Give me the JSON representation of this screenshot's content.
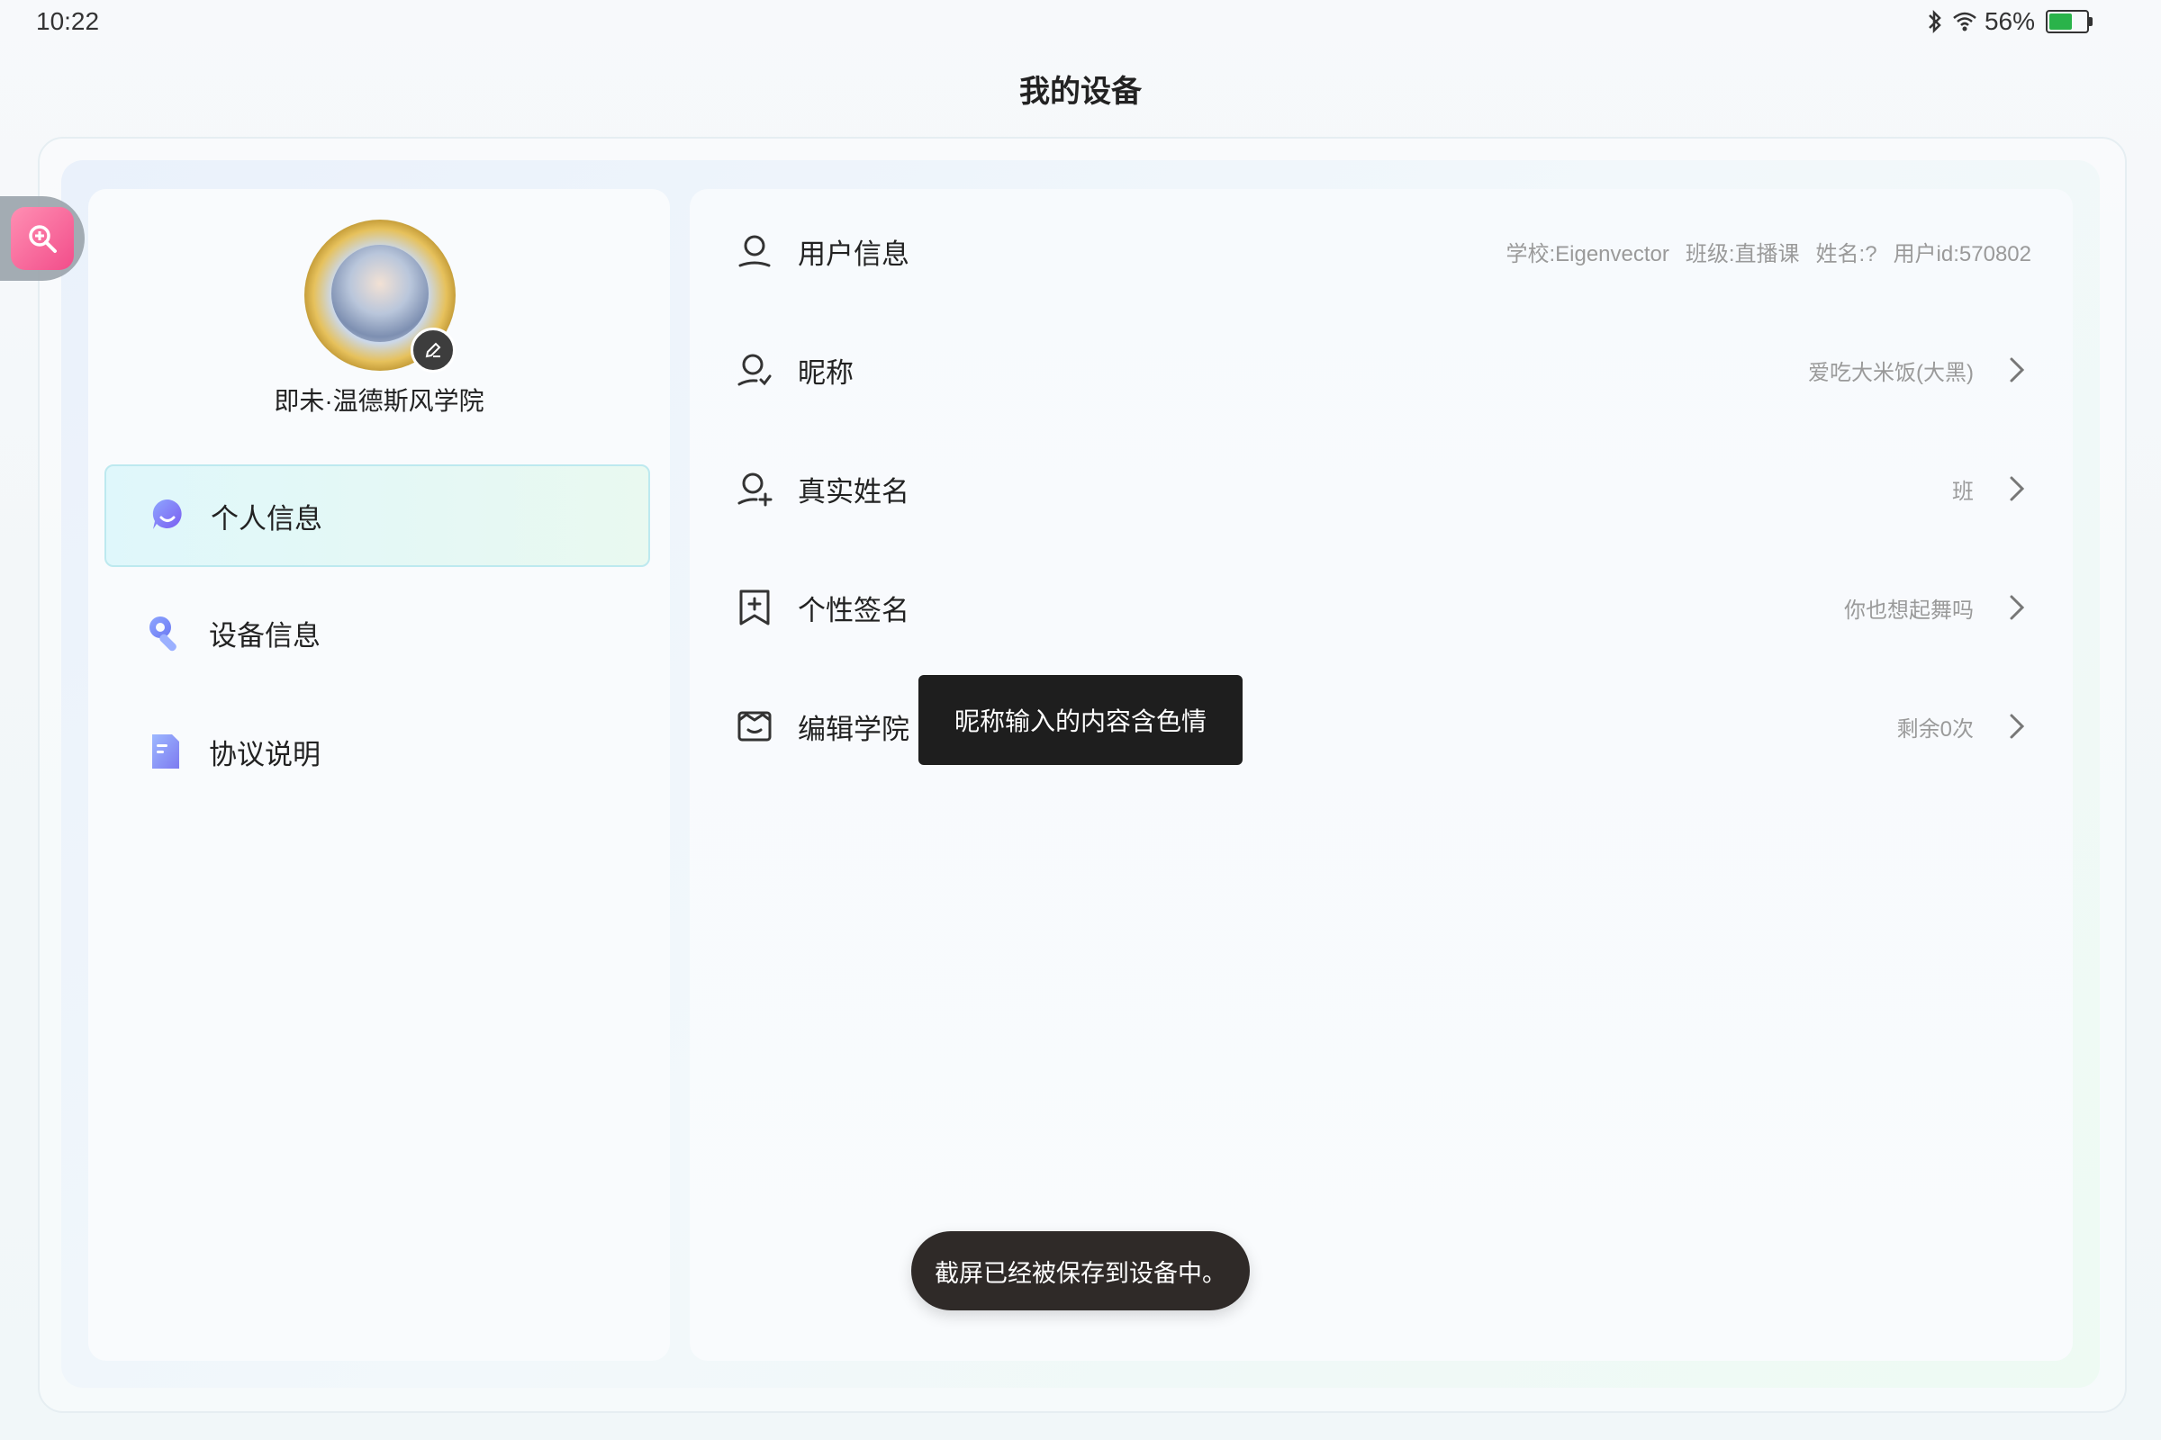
{
  "status_bar": {
    "time": "10:22",
    "battery_percent": "56%",
    "battery_level": 0.56,
    "icons": [
      "bluetooth-icon",
      "wifi-icon",
      "battery-icon"
    ]
  },
  "page": {
    "title": "我的设备"
  },
  "profile": {
    "academy_name": "即未·温德斯风学院"
  },
  "sidebar": {
    "items": [
      {
        "label": "个人信息",
        "icon": "person-chat-icon",
        "active": true
      },
      {
        "label": "设备信息",
        "icon": "wrench-icon",
        "active": false
      },
      {
        "label": "协议说明",
        "icon": "document-icon",
        "active": false
      }
    ]
  },
  "details": {
    "user_info": {
      "label": "用户信息",
      "school": "学校:Eigenvector",
      "class": "班级:直播课",
      "name": "姓名:?",
      "user_id": "用户id:570802"
    },
    "nickname": {
      "label": "昵称",
      "value": "爱吃大米饭(大黑)"
    },
    "real_name": {
      "label": "真实姓名",
      "value": "班"
    },
    "signature": {
      "label": "个性签名",
      "value": "你也想起舞吗"
    },
    "academy": {
      "label": "编辑学院",
      "value": "剩余0次"
    }
  },
  "tooltip": {
    "text": "昵称输入的内容含色情"
  },
  "toast": {
    "text": "截屏已经被保存到设备中。"
  },
  "colors": {
    "accent_pink": "#f24d8a",
    "nav_active_bg": "#dff7fb",
    "battery_green": "#2ab34a",
    "toast_bg": "#2f2a28"
  }
}
